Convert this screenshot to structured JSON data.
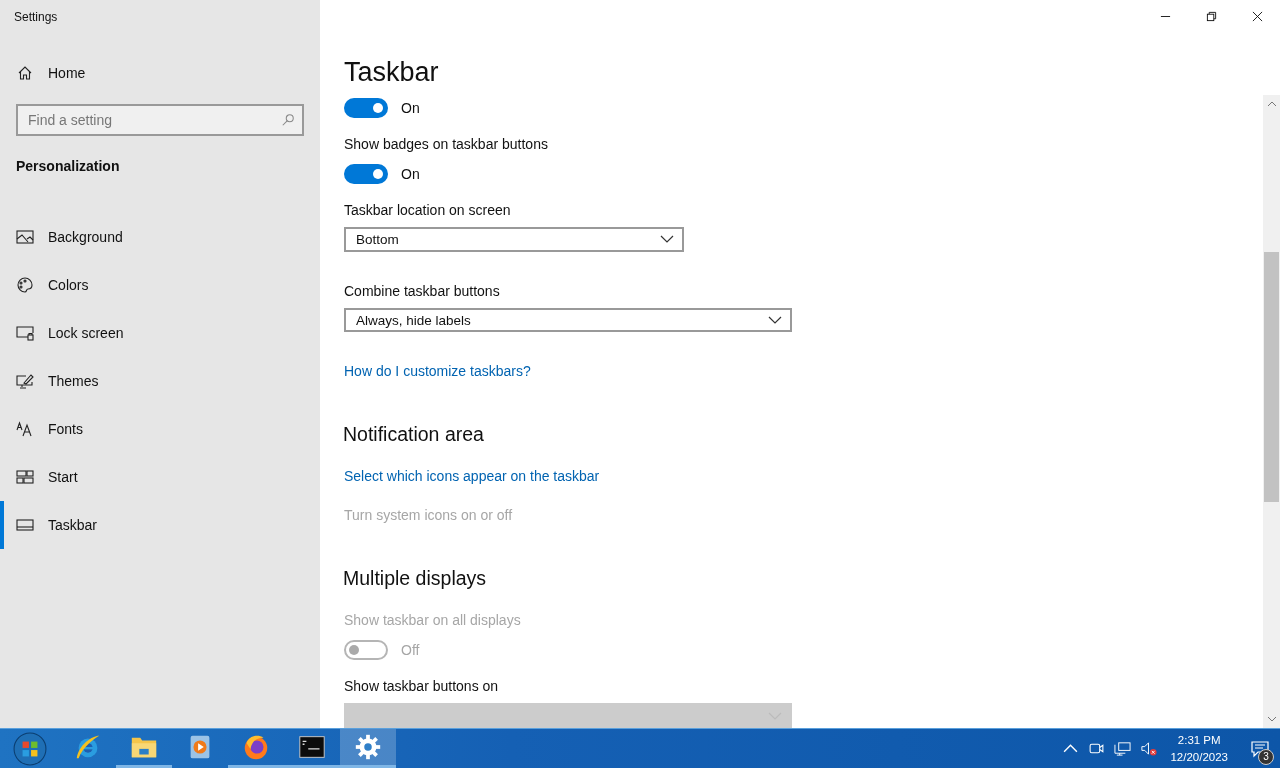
{
  "window": {
    "title": "Settings"
  },
  "sidebar": {
    "home": "Home",
    "search": {
      "placeholder": "Find a setting"
    },
    "section": "Personalization",
    "items": [
      {
        "label": "Background",
        "selected": false
      },
      {
        "label": "Colors",
        "selected": false
      },
      {
        "label": "Lock screen",
        "selected": false
      },
      {
        "label": "Themes",
        "selected": false
      },
      {
        "label": "Fonts",
        "selected": false
      },
      {
        "label": "Start",
        "selected": false
      },
      {
        "label": "Taskbar",
        "selected": true
      }
    ]
  },
  "page": {
    "title": "Taskbar"
  },
  "settings": [
    {
      "kind": "toggle",
      "on": true,
      "state": "On",
      "disabled": false
    },
    {
      "kind": "label",
      "text": "Show badges on taskbar buttons",
      "disabled": false
    },
    {
      "kind": "toggle",
      "on": true,
      "state": "On",
      "disabled": false
    },
    {
      "kind": "label",
      "text": "Taskbar location on screen",
      "disabled": false
    },
    {
      "kind": "dropdown",
      "value": "Bottom",
      "disabled": false
    },
    {
      "kind": "label",
      "text": "Combine taskbar buttons",
      "disabled": false
    },
    {
      "kind": "dropdown",
      "value": "Always, hide labels",
      "disabled": false
    },
    {
      "kind": "link",
      "text": "How do I customize taskbars?",
      "disabled": false
    },
    {
      "kind": "heading",
      "text": "Notification area"
    },
    {
      "kind": "link",
      "text": "Select which icons appear on the taskbar",
      "disabled": false
    },
    {
      "kind": "link",
      "text": "Turn system icons on or off",
      "disabled": true
    },
    {
      "kind": "heading",
      "text": "Multiple displays"
    },
    {
      "kind": "label",
      "text": "Show taskbar on all displays",
      "disabled": true
    },
    {
      "kind": "toggle",
      "on": false,
      "state": "Off",
      "disabled": true
    },
    {
      "kind": "label",
      "text": "Show taskbar buttons on",
      "disabled": false
    },
    {
      "kind": "dropdown",
      "disabled": true
    }
  ],
  "taskbar": {
    "apps": [
      {
        "running": false,
        "selected": false
      },
      {
        "running": true,
        "selected": false
      },
      {
        "running": false,
        "selected": false
      },
      {
        "running": true,
        "selected": false
      },
      {
        "running": true,
        "selected": false
      },
      {
        "running": true,
        "selected": true
      }
    ],
    "time": "2:31 PM",
    "date": "12/20/2023",
    "notifications": "3"
  }
}
